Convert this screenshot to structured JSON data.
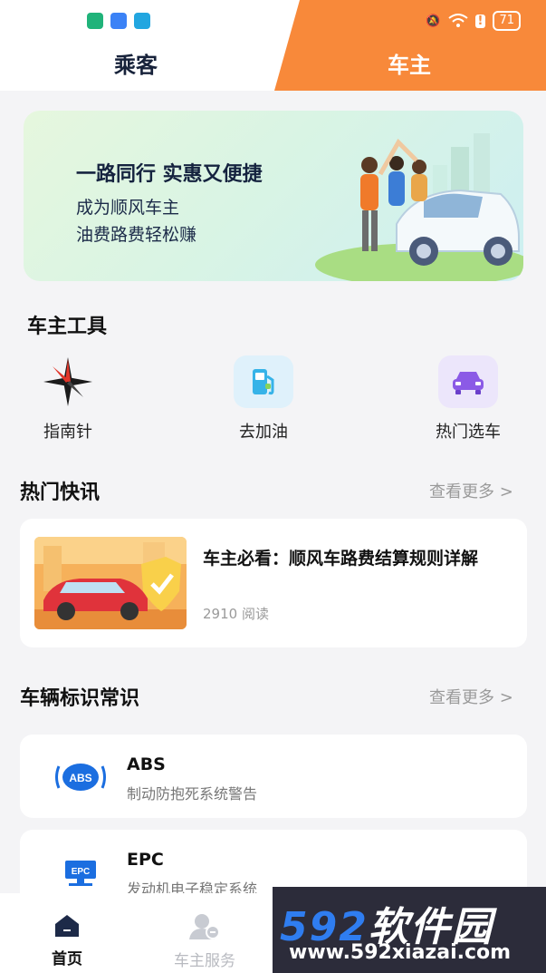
{
  "status_bar": {
    "battery": "71"
  },
  "tabs": {
    "passenger": "乘客",
    "driver": "车主"
  },
  "banner": {
    "title": "一路同行 实惠又便捷",
    "line1": "成为顺风车主",
    "line2": "油费路费轻松赚"
  },
  "tools": {
    "title": "车主工具",
    "items": [
      {
        "label": "指南针",
        "icon": "compass-icon"
      },
      {
        "label": "去加油",
        "icon": "fuel-pump-icon"
      },
      {
        "label": "热门选车",
        "icon": "car-icon"
      }
    ]
  },
  "news": {
    "title": "热门快讯",
    "more": "查看更多 >",
    "item": {
      "title": "车主必看：顺风车路费结算规则详解",
      "reads": "2910 阅读"
    }
  },
  "signs": {
    "title": "车辆标识常识",
    "more": "查看更多 >",
    "items": [
      {
        "code": "ABS",
        "desc": "制动防抱死系统警告"
      },
      {
        "code": "EPC",
        "desc": "发动机电子稳定系统"
      }
    ]
  },
  "bottom_nav": {
    "home": "首页",
    "service": "车主服务"
  },
  "watermark": {
    "big_num": "592",
    "big_text": "软件园",
    "url": "www.592xiazai.com"
  },
  "colors": {
    "accent": "#f8893a",
    "navy": "#17223a"
  }
}
